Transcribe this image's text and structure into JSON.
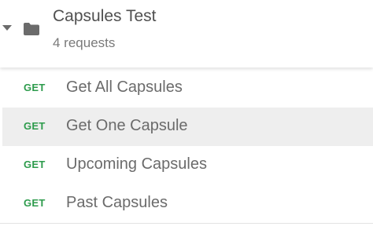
{
  "collection": {
    "name": "Capsules Test",
    "meta": "4 requests",
    "folder_icon": "folder-icon",
    "expand_icon": "caret-down-icon"
  },
  "requests": [
    {
      "method": "GET",
      "name": "Get All Capsules",
      "selected": false
    },
    {
      "method": "GET",
      "name": "Get One Capsule",
      "selected": true
    },
    {
      "method": "GET",
      "name": "Upcoming Capsules",
      "selected": false
    },
    {
      "method": "GET",
      "name": "Past Capsules",
      "selected": false
    }
  ],
  "colors": {
    "method_get": "#2d9b4c",
    "selected_row": "#eeeeee",
    "text_primary": "#505050",
    "text_secondary": "#7a7a7a"
  }
}
